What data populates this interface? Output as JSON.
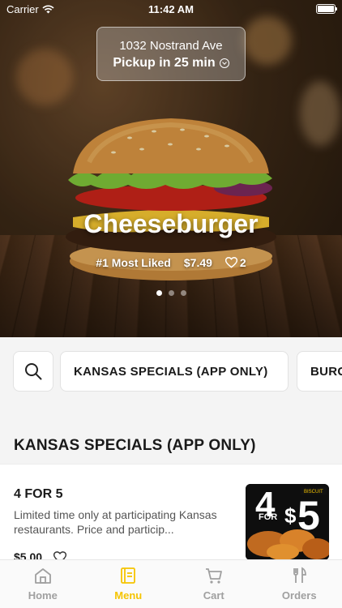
{
  "status_bar": {
    "carrier": "Carrier",
    "time": "11:42 AM"
  },
  "location": {
    "address": "1032 Nostrand Ave",
    "pickup": "Pickup in 25 min"
  },
  "hero": {
    "title": "Cheeseburger",
    "badge": "#1 Most Liked",
    "price": "$7.49",
    "likes": "2",
    "carousel": {
      "count": 3,
      "active_index": 0
    }
  },
  "categories": {
    "search_icon": "search-icon",
    "items": [
      "KANSAS SPECIALS (APP ONLY)",
      "BURG"
    ]
  },
  "section": {
    "title": "KANSAS SPECIALS (APP ONLY)"
  },
  "items": [
    {
      "name": "4 FOR 5",
      "description": "Limited time only at participating Kansas restaurants. Price and particip...",
      "price": "$5.00",
      "thumb_big": "4",
      "thumb_for": "FOR",
      "thumb_dollar": "$",
      "thumb_five": "5",
      "thumb_brand": "BISCUIT"
    }
  ],
  "tab_bar": {
    "tabs": [
      {
        "label": "Home",
        "icon": "home-icon",
        "active": false
      },
      {
        "label": "Menu",
        "icon": "menu-icon",
        "active": true
      },
      {
        "label": "Cart",
        "icon": "cart-icon",
        "active": false
      },
      {
        "label": "Orders",
        "icon": "utensils-icon",
        "active": false
      }
    ]
  },
  "colors": {
    "accent": "#f5c400",
    "inactive_tab": "#a0a0a0"
  }
}
